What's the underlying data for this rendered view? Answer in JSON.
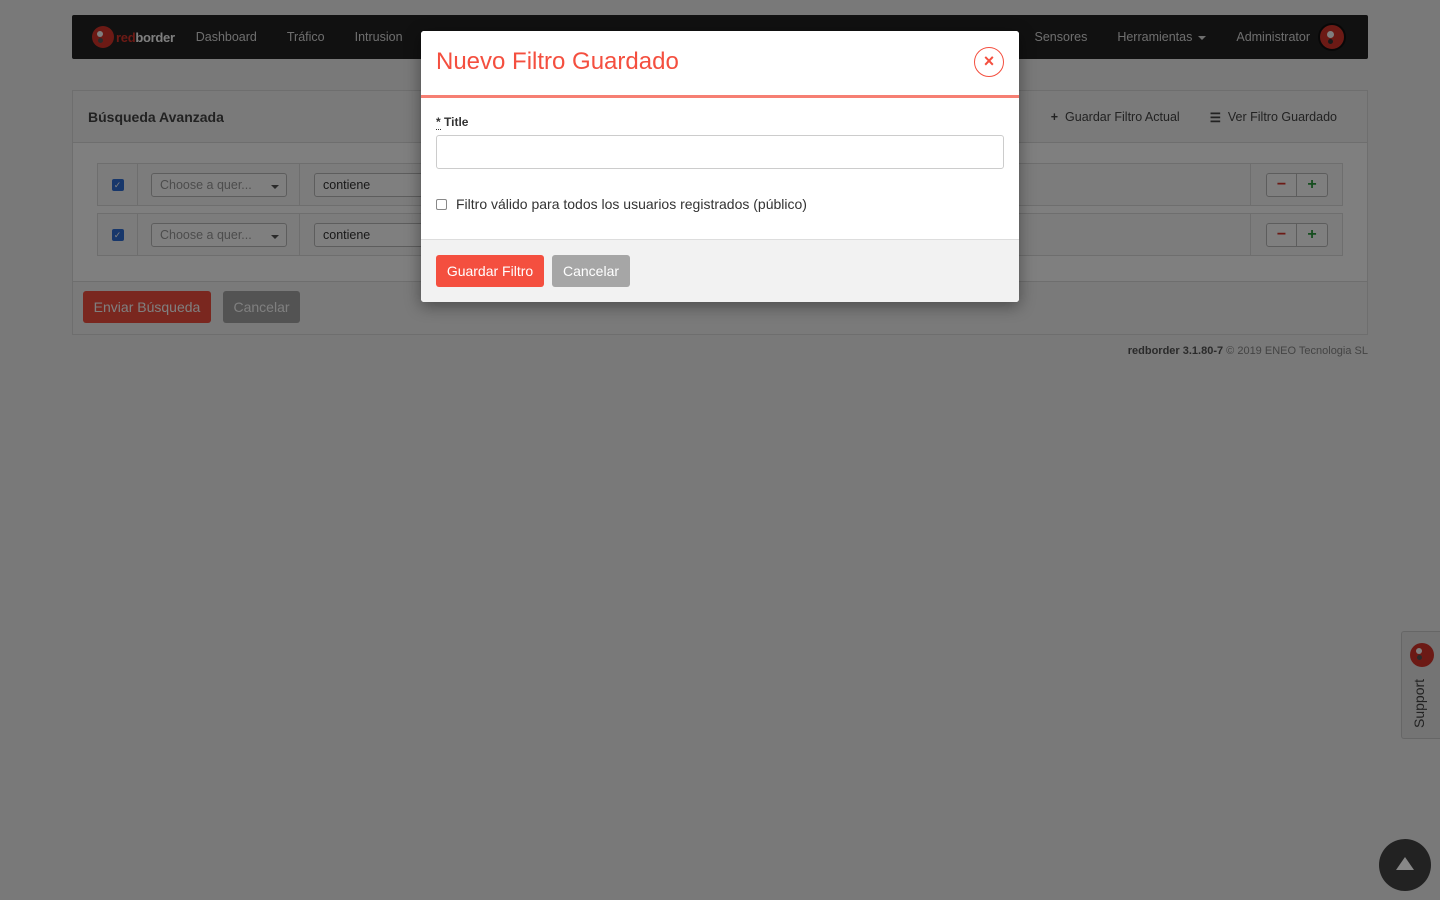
{
  "navbar": {
    "brand_red": "red",
    "brand_white": "border",
    "items": [
      "Dashboard",
      "Tráfico",
      "Intrusion"
    ],
    "right_items": [
      "Sensores",
      "Herramientas"
    ],
    "user": "Administrator"
  },
  "panel": {
    "title": "Búsqueda Avanzada",
    "save_current": "Guardar Filtro Actual",
    "view_saved": "Ver Filtro Guardado",
    "rows": [
      {
        "field_placeholder": "Choose a quer...",
        "operator": "contiene",
        "checked": true
      },
      {
        "field_placeholder": "Choose a quer...",
        "operator": "contiene",
        "checked": true
      }
    ],
    "minus": "−",
    "plus": "+",
    "submit": "Enviar Búsqueda",
    "cancel": "Cancelar"
  },
  "footer": {
    "product": "redborder 3.1.80-7",
    "copyright": "© 2019 ENEO Tecnologia SL"
  },
  "modal": {
    "title": "Nuevo Filtro Guardado",
    "close_symbol": "×",
    "field_required_mark": "*",
    "field_label": "Title",
    "title_value": "",
    "public_label": "Filtro válido para todos los usuarios registrados (público)",
    "public_checked": false,
    "save_button": "Guardar Filtro",
    "cancel_button": "Cancelar"
  },
  "support": {
    "label": "Support"
  },
  "colors": {
    "accent": "#f44f3f",
    "brand": "#d9342b",
    "navbar": "#222222"
  }
}
